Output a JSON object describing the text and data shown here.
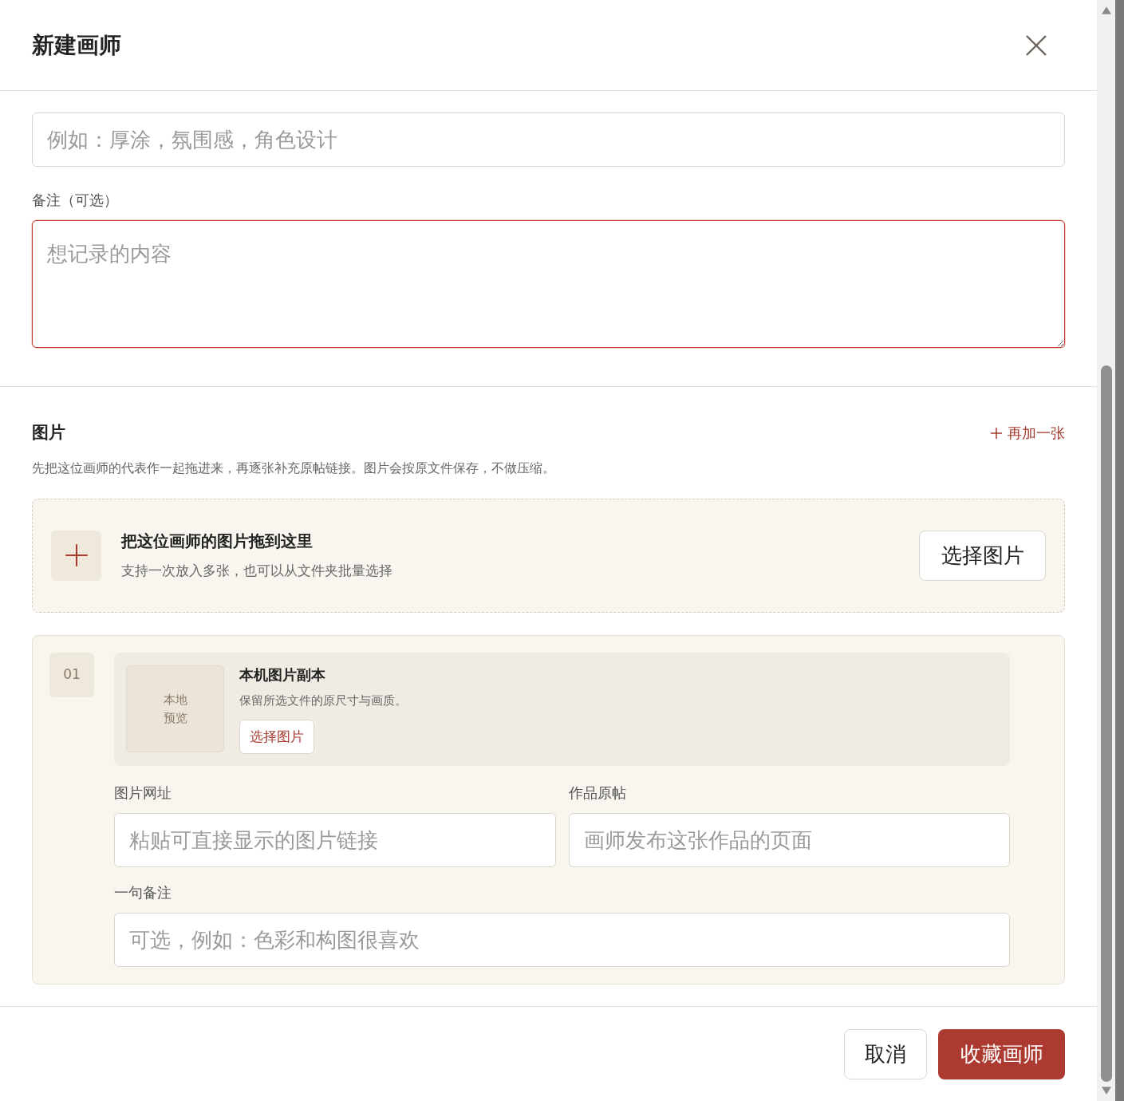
{
  "dialog": {
    "title": "新建画师"
  },
  "tags_field": {
    "placeholder": "例如：厚涂，氛围感，角色设计"
  },
  "notes": {
    "label": "备注（可选）",
    "placeholder": "想记录的内容",
    "focused": true
  },
  "images": {
    "title": "图片",
    "add_more": "再加一张",
    "description": "先把这位画师的代表作一起拖进来，再逐张补充原帖链接。图片会按原文件保存，不做压缩。",
    "dropzone": {
      "title": "把这位画师的图片拖到这里",
      "hint": "支持一次放入多张，也可以从文件夹批量选择",
      "button": "选择图片"
    },
    "items": [
      {
        "index": "01",
        "preview": [
          "本地",
          "预览"
        ],
        "source_title": "本机图片副本",
        "source_hint": "保留所选文件的原尺寸与画质。",
        "choose_button": "选择图片",
        "url_label": "图片网址",
        "url_placeholder": "粘贴可直接显示的图片链接",
        "post_label": "作品原帖",
        "post_placeholder": "画师发布这张作品的页面",
        "note_label": "一句备注",
        "note_placeholder": "可选，例如：色彩和构图很喜欢"
      }
    ]
  },
  "footer": {
    "cancel": "取消",
    "submit": "收藏画师"
  }
}
